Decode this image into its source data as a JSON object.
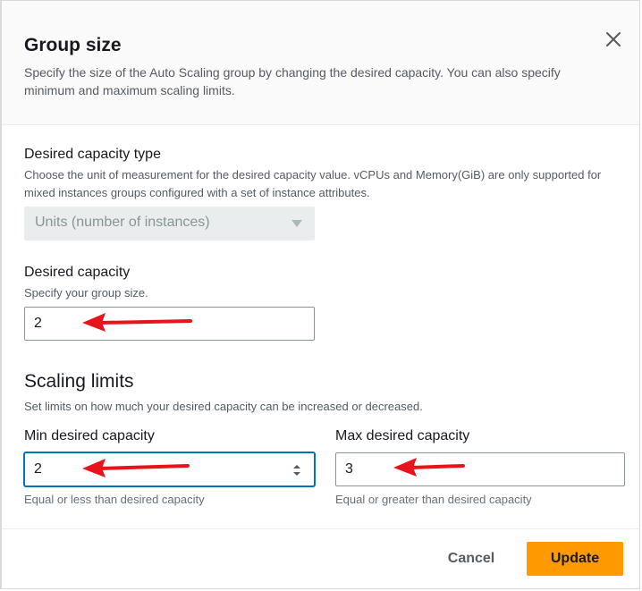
{
  "modal": {
    "title": "Group size",
    "description": "Specify the size of the Auto Scaling group by changing the desired capacity. You can also specify minimum and maximum scaling limits."
  },
  "capacity_type": {
    "label": "Desired capacity type",
    "description": "Choose the unit of measurement for the desired capacity value. vCPUs and Memory(GiB) are only supported for mixed instances groups configured with a set of instance attributes.",
    "selected": "Units (number of instances)",
    "disabled": true
  },
  "desired_capacity": {
    "label": "Desired capacity",
    "description": "Specify your group size.",
    "value": "2"
  },
  "scaling_limits": {
    "title": "Scaling limits",
    "description": "Set limits on how much your desired capacity can be increased or decreased.",
    "min": {
      "label": "Min desired capacity",
      "value": "2",
      "hint": "Equal or less than desired capacity"
    },
    "max": {
      "label": "Max desired capacity",
      "value": "3",
      "hint": "Equal or greater than desired capacity"
    }
  },
  "footer": {
    "cancel_label": "Cancel",
    "update_label": "Update"
  },
  "colors": {
    "primary_button": "#ff9900",
    "focus_border": "#0073bb",
    "annotation_arrow": "#e8141c"
  },
  "icons": {
    "close": "close-icon",
    "select_caret": "caret-down-icon",
    "spinner": "number-spinner-icon",
    "annotation": "red-arrow-annotation"
  }
}
